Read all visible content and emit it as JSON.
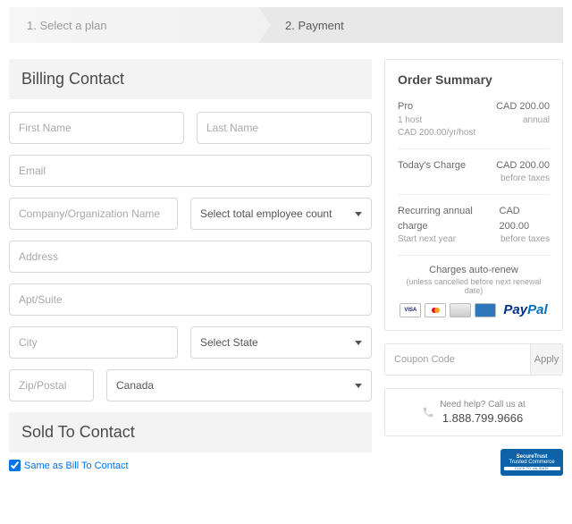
{
  "steps": {
    "step1": "1. Select a plan",
    "step2": "2. Payment"
  },
  "billing": {
    "title": "Billing Contact",
    "first_name_ph": "First Name",
    "last_name_ph": "Last Name",
    "email_ph": "Email",
    "company_ph": "Company/Organization Name",
    "employee_ph": "Select total employee count",
    "address_ph": "Address",
    "apt_ph": "Apt/Suite",
    "city_ph": "City",
    "state_ph": "Select State",
    "zip_ph": "Zip/Postal",
    "country": "Canada"
  },
  "sold": {
    "title": "Sold To Contact",
    "same_label": "Same as Bill To Contact"
  },
  "summary": {
    "title": "Order Summary",
    "plan": "Pro",
    "plan_price": "CAD 200.00",
    "plan_hosts": "1 host",
    "plan_billing": "annual",
    "plan_rate": "CAD 200.00/yr/host",
    "today_label": "Today's Charge",
    "today_value": "CAD 200.00",
    "today_sub": "before taxes",
    "recur_label": "Recurring annual charge",
    "recur_value": "CAD 200.00",
    "recur_sub1": "Start next year",
    "recur_sub2": "before taxes",
    "auto": "Charges auto-renew",
    "auto_sub": "(unless cancelled before next renewal date)"
  },
  "coupon": {
    "ph": "Coupon Code",
    "apply": "Apply"
  },
  "help": {
    "text": "Need help? Call us at",
    "number": "1.888.799.9666"
  },
  "badge": {
    "l1": "SecureTrust",
    "l2": "Trusted Commerce",
    "l3": "CLICK TO VALIDATE"
  },
  "cards": {
    "visa": "VISA"
  }
}
